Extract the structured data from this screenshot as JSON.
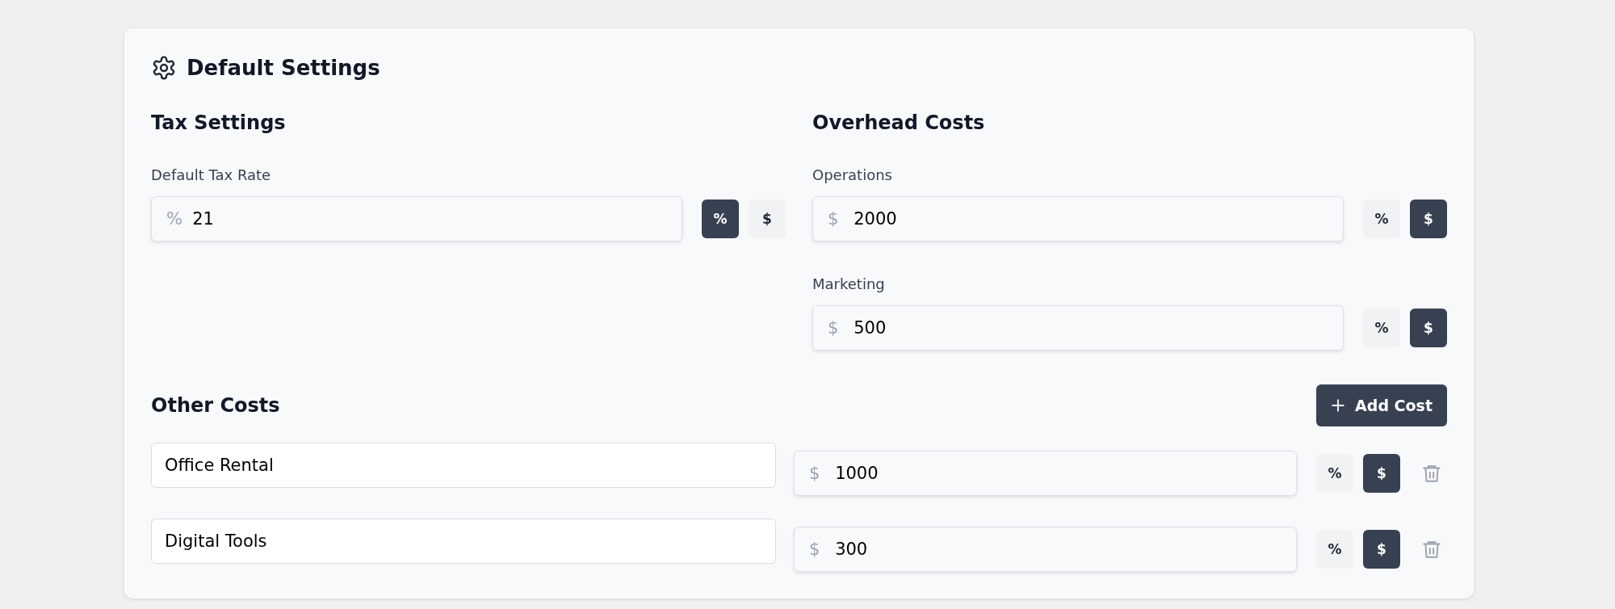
{
  "title": "Default Settings",
  "tax": {
    "heading": "Tax Settings",
    "fields": [
      {
        "label": "Default Tax Rate",
        "prefix": "%",
        "value": "21",
        "units": [
          {
            "label": "%",
            "selected": true
          },
          {
            "label": "$",
            "selected": false
          }
        ]
      }
    ]
  },
  "overhead": {
    "heading": "Overhead Costs",
    "fields": [
      {
        "label": "Operations",
        "prefix": "$",
        "value": "2000",
        "units": [
          {
            "label": "%",
            "selected": false
          },
          {
            "label": "$",
            "selected": true
          }
        ]
      },
      {
        "label": "Marketing",
        "prefix": "$",
        "value": "500",
        "units": [
          {
            "label": "%",
            "selected": false
          },
          {
            "label": "$",
            "selected": true
          }
        ]
      }
    ]
  },
  "other": {
    "heading": "Other Costs",
    "add_button": "Add Cost",
    "rows": [
      {
        "name": "Office Rental",
        "prefix": "$",
        "value": "1000",
        "units": [
          {
            "label": "%",
            "selected": false
          },
          {
            "label": "$",
            "selected": true
          }
        ]
      },
      {
        "name": "Digital Tools",
        "prefix": "$",
        "value": "300",
        "units": [
          {
            "label": "%",
            "selected": false
          },
          {
            "label": "$",
            "selected": true
          }
        ]
      }
    ]
  }
}
